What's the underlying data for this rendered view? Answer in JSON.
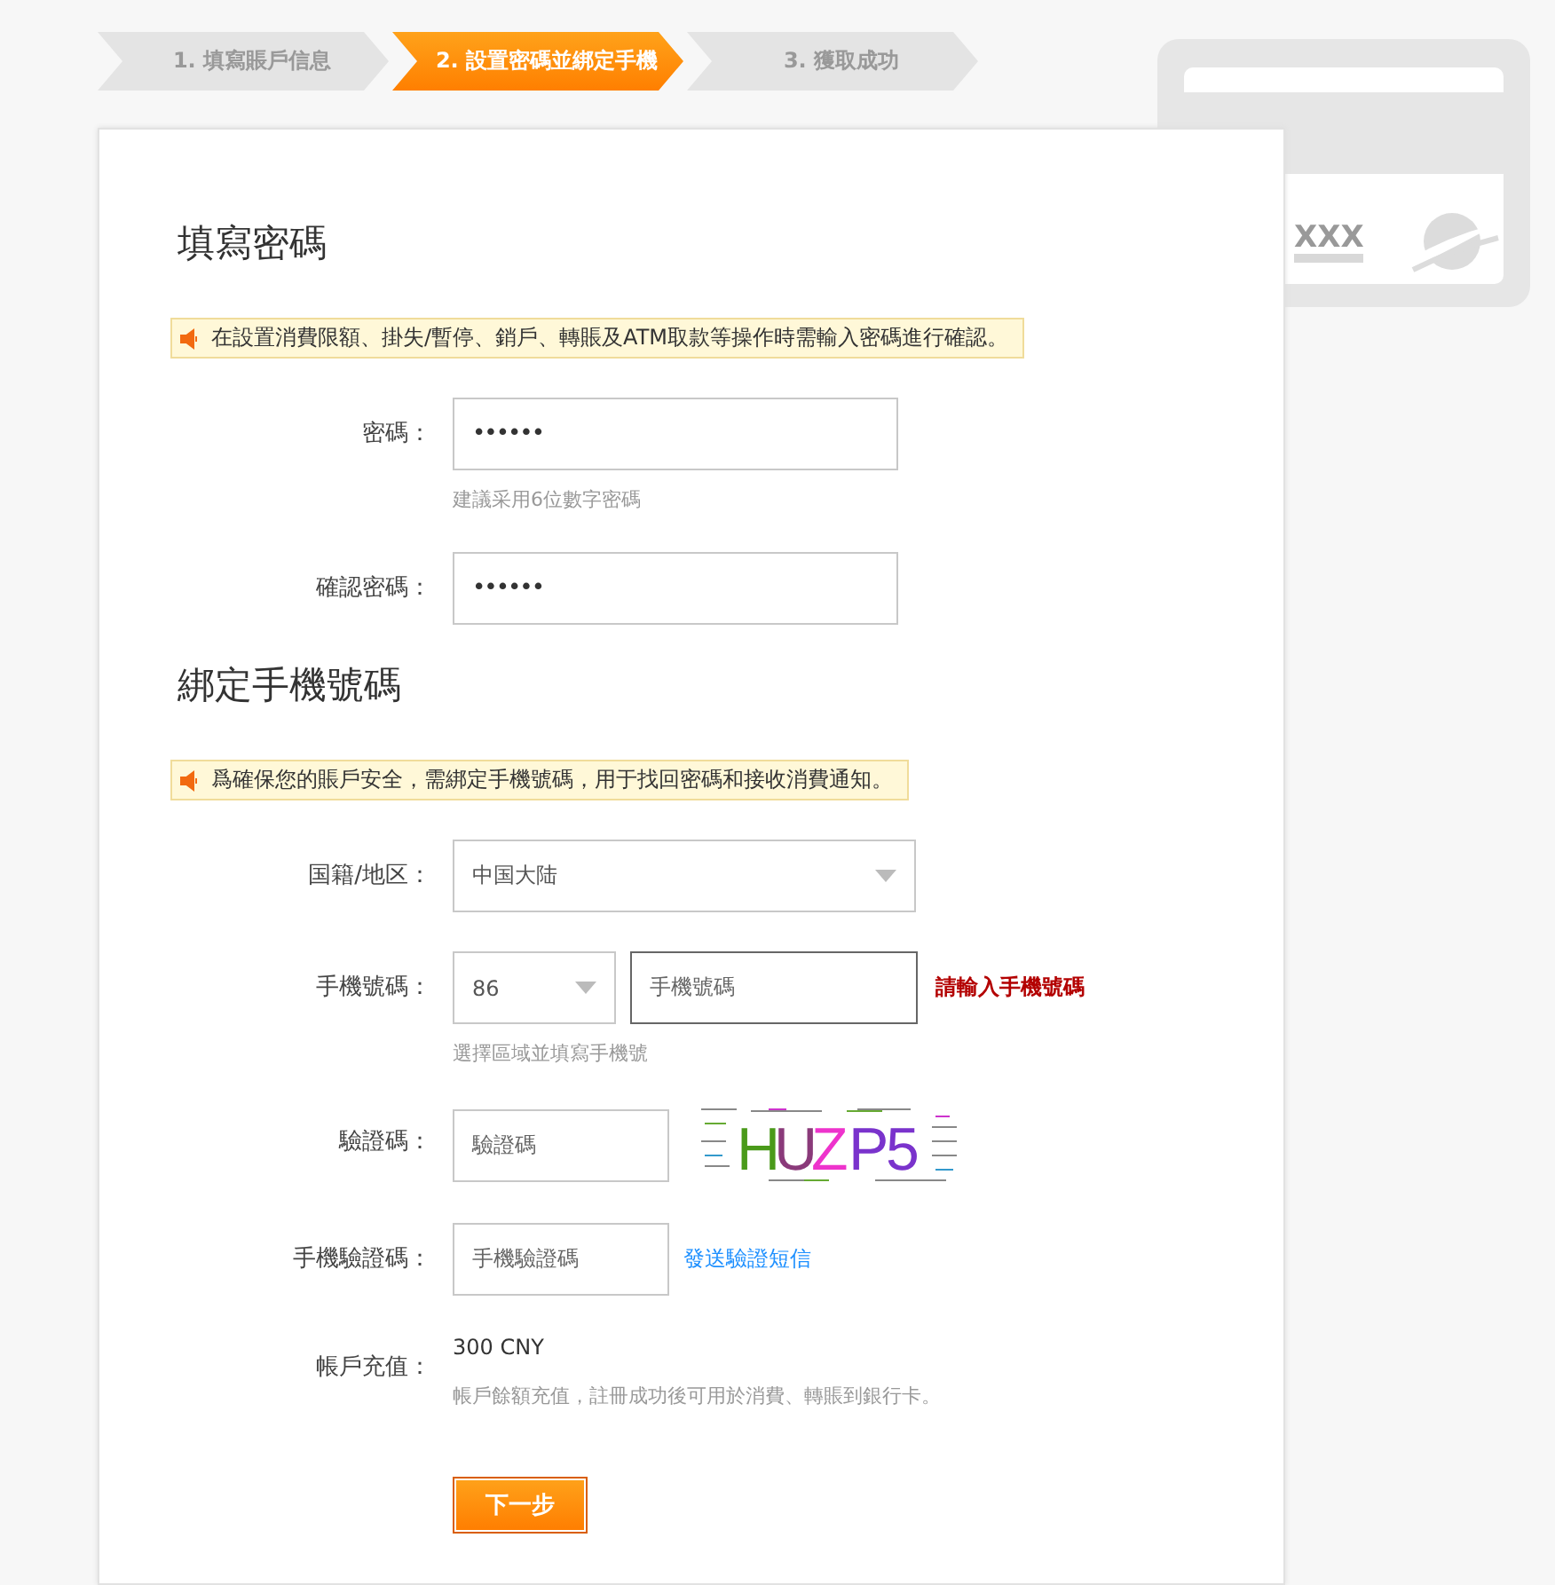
{
  "steps": [
    {
      "label": "1. 填寫賬戶信息",
      "selected": false
    },
    {
      "label": "2. 設置密碼並綁定手機",
      "selected": true
    },
    {
      "label": "3. 獲取成功",
      "selected": false
    }
  ],
  "card": {
    "number": "XXX"
  },
  "sections": [
    {
      "title": "填寫密碼",
      "notice": "在設置消費限額、掛失/暫停、銷戶、轉賬及ATM取款等操作時需輸入密碼進行確認。",
      "fields": [
        {
          "kind": "password",
          "label": "密碼：",
          "value": "••••••",
          "hint": "建議采用6位數字密碼"
        },
        {
          "kind": "password",
          "label": "確認密碼：",
          "value": "••••••"
        }
      ]
    },
    {
      "title": "綁定手機號碼",
      "notice": "爲確保您的賬戶安全，需綁定手機號碼，用于找回密碼和接收消費通知。",
      "fields": [
        {
          "kind": "select",
          "label": "国籍/地区：",
          "value": "中国大陆"
        },
        {
          "kind": "phone",
          "label": "手機號碼：",
          "code": "86",
          "placeholder": "手機號碼",
          "error": "請輸入手機號碼",
          "hint": "選擇區域並填寫手機號"
        },
        {
          "kind": "captcha",
          "label": "驗證碼：",
          "placeholder": "驗證碼",
          "captcha_text": "HUZP5"
        },
        {
          "kind": "sms",
          "label": "手機驗證碼：",
          "placeholder": "手機驗證碼",
          "link": "發送驗證短信"
        },
        {
          "kind": "balance",
          "label": "帳戶充值：",
          "value": "300 CNY",
          "hint": "帳戶餘額充值，註冊成功後可用於消費、轉賬到銀行卡。"
        }
      ]
    }
  ],
  "button": "下一步"
}
